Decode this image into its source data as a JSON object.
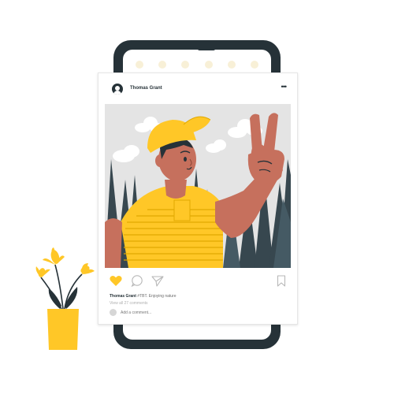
{
  "post": {
    "username": "Thomas Grant",
    "menu_icon": "more-horizontal-icon",
    "caption_user": "Thomas Grant",
    "caption_text": "#TBT. Enjoying nature",
    "view_comments": "View all 27 comments",
    "add_comment_placeholder": "Add a comment...",
    "liked": true
  },
  "icons": {
    "like": "heart-icon",
    "comment": "comment-bubble-icon",
    "share": "send-icon",
    "save": "bookmark-icon"
  },
  "colors": {
    "accent": "#FFC727",
    "dark": "#263238",
    "skin": "#C6705D"
  }
}
